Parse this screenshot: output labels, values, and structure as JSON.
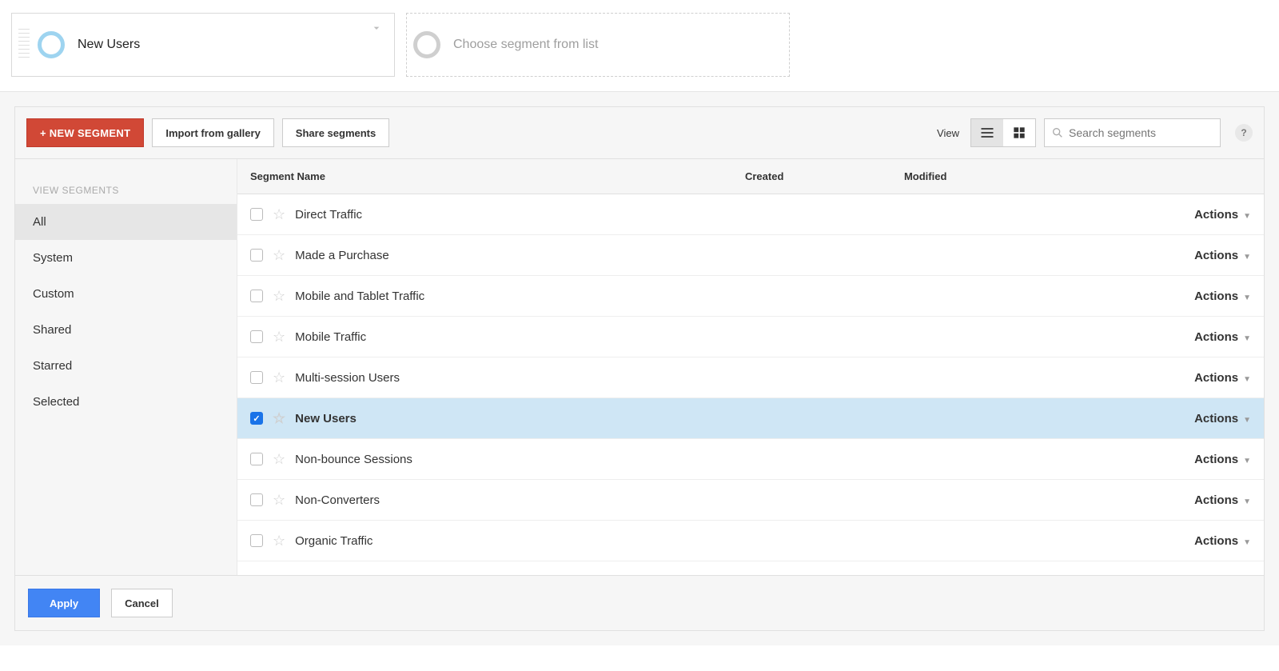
{
  "top_chips": {
    "selected": {
      "label": "New Users"
    },
    "placeholder": {
      "label": "Choose segment from list"
    }
  },
  "toolbar": {
    "new_segment": "+ NEW SEGMENT",
    "import_gallery": "Import from gallery",
    "share_segments": "Share segments",
    "view_label": "View",
    "search_placeholder": "Search segments"
  },
  "sidebar": {
    "heading": "VIEW SEGMENTS",
    "items": [
      {
        "label": "All",
        "active": true
      },
      {
        "label": "System",
        "active": false
      },
      {
        "label": "Custom",
        "active": false
      },
      {
        "label": "Shared",
        "active": false
      },
      {
        "label": "Starred",
        "active": false
      },
      {
        "label": "Selected",
        "active": false
      }
    ]
  },
  "table": {
    "headers": {
      "name": "Segment Name",
      "created": "Created",
      "modified": "Modified"
    },
    "action_label": "Actions",
    "rows": [
      {
        "name": "Direct Traffic",
        "selected": false
      },
      {
        "name": "Made a Purchase",
        "selected": false
      },
      {
        "name": "Mobile and Tablet Traffic",
        "selected": false
      },
      {
        "name": "Mobile Traffic",
        "selected": false
      },
      {
        "name": "Multi-session Users",
        "selected": false
      },
      {
        "name": "New Users",
        "selected": true
      },
      {
        "name": "Non-bounce Sessions",
        "selected": false
      },
      {
        "name": "Non-Converters",
        "selected": false
      },
      {
        "name": "Organic Traffic",
        "selected": false
      }
    ]
  },
  "footer": {
    "apply": "Apply",
    "cancel": "Cancel"
  }
}
